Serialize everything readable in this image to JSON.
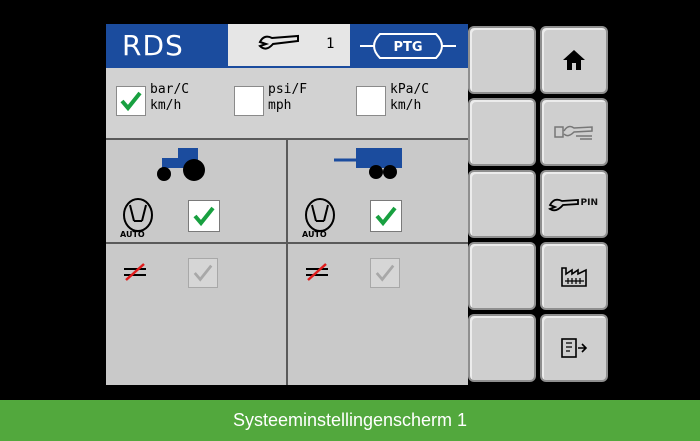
{
  "header": {
    "title": "RDS",
    "setting_number": "1",
    "logo_text": "PTG",
    "colors": {
      "header_blue": "#1b4c9e",
      "check_green": "#18a040"
    }
  },
  "units": [
    {
      "line1": "bar/C",
      "line2": "km/h",
      "checked": true
    },
    {
      "line1": "psi/F",
      "line2": "mph",
      "checked": false
    },
    {
      "line1": "kPa/C",
      "line2": "km/h",
      "checked": false
    }
  ],
  "axles": {
    "tractor": {
      "auto_label": "AUTO",
      "auto_checked": true,
      "noslip_checked_disabled": true
    },
    "trailer": {
      "auto_label": "AUTO",
      "auto_checked": true,
      "noslip_checked_disabled": true
    }
  },
  "softkeys": {
    "right": [
      {
        "icon": "home-icon"
      },
      {
        "icon": "wrench-settings-icon"
      },
      {
        "icon": "wrench-pin-icon",
        "label": "PIN"
      },
      {
        "icon": "factory-icon"
      },
      {
        "icon": "exit-icon"
      }
    ],
    "left_count": 5
  },
  "caption": "Systeeminstellingenscherm 1"
}
